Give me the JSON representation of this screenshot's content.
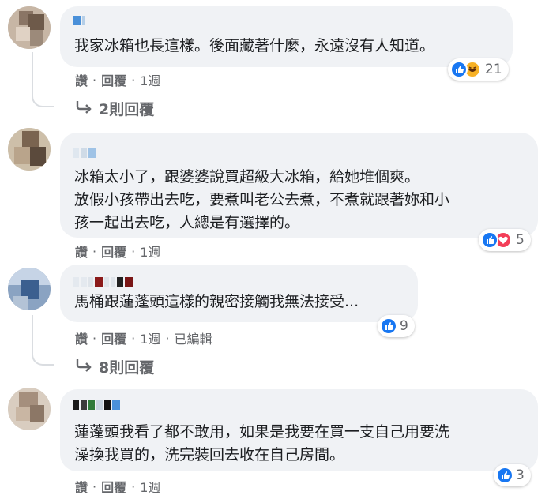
{
  "comments": [
    {
      "text_lines": [
        "我家冰箱也長這樣。後面藏著什麼，永遠沒有人知道。"
      ],
      "reactions": {
        "icons": [
          "like-icon",
          "haha-icon"
        ],
        "count": "21"
      },
      "actions": {
        "like": "讚",
        "reply": "回覆",
        "time": "1週",
        "edited": ""
      },
      "replies_label": "2則回覆"
    },
    {
      "text_lines": [
        "冰箱太小了，跟婆婆說買超級大冰箱，給她堆個爽。",
        "放假小孩帶出去吃，要煮叫老公去煮，不煮就跟著妳和小",
        "孩一起出去吃，人總是有選擇的。"
      ],
      "reactions": {
        "icons": [
          "like-icon",
          "love-icon"
        ],
        "count": "5"
      },
      "actions": {
        "like": "讚",
        "reply": "回覆",
        "time": "1週",
        "edited": ""
      },
      "replies_label": ""
    },
    {
      "text_lines": [
        "馬桶跟蓮蓬頭這樣的親密接觸我無法接受..."
      ],
      "reactions": {
        "icons": [
          "like-icon"
        ],
        "count": "9"
      },
      "actions": {
        "like": "讚",
        "reply": "回覆",
        "time": "1週",
        "edited": "已編輯"
      },
      "replies_label": "8則回覆"
    },
    {
      "text_lines": [
        "蓮蓬頭我看了都不敢用，如果是我要在買一支自己用要洗",
        "澡換我買的，洗完裝回去收在自己房間。"
      ],
      "reactions": {
        "icons": [
          "like-icon"
        ],
        "count": "3"
      },
      "actions": {
        "like": "讚",
        "reply": "回覆",
        "time": "1週",
        "edited": ""
      },
      "replies_label": ""
    }
  ],
  "colors": {
    "like": "#1877f2",
    "love": "#f33e58",
    "haha": "#f7b125",
    "bubble": "#f0f2f5",
    "meta_text": "#65676b"
  }
}
